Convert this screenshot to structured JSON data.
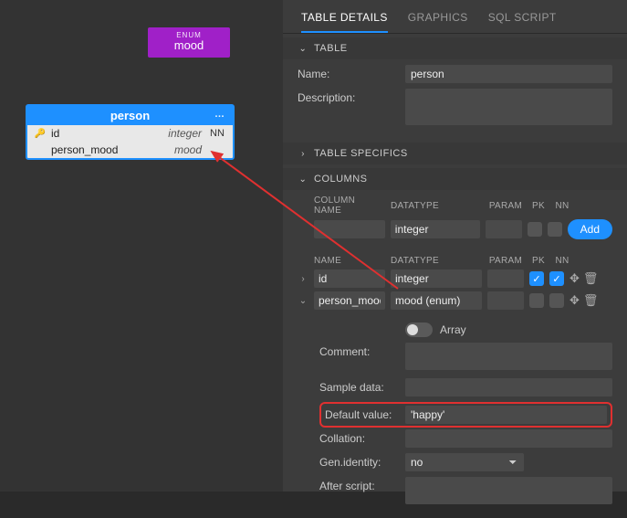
{
  "canvas": {
    "enum": {
      "tag": "ENUM",
      "name": "mood"
    },
    "table": {
      "name": "person",
      "rows": [
        {
          "key": "🔑",
          "name": "id",
          "datatype": "integer",
          "nn": "NN"
        },
        {
          "key": "",
          "name": "person_mood",
          "datatype": "mood",
          "nn": ""
        }
      ]
    }
  },
  "panel": {
    "tabs": [
      "TABLE DETAILS",
      "GRAPHICS",
      "SQL SCRIPT"
    ],
    "active_tab": 0,
    "section_table": "TABLE",
    "name_label": "Name:",
    "name_value": "person",
    "desc_label": "Description:",
    "section_specifics": "TABLE SPECIFICS",
    "section_columns": "COLUMNS",
    "cols_header": {
      "name": "COLUMN NAME",
      "dt": "DATATYPE",
      "param": "PARAM",
      "pk": "PK",
      "nn": "NN"
    },
    "new_col": {
      "name": "",
      "datatype": "integer",
      "param": ""
    },
    "add_label": "Add",
    "col_list_header": {
      "name": "NAME",
      "dt": "DATATYPE",
      "param": "PARAM",
      "pk": "PK",
      "nn": "NN"
    },
    "columns": [
      {
        "name": "id",
        "datatype": "integer",
        "param": "",
        "pk": true,
        "nn": true,
        "expanded": false
      },
      {
        "name": "person_mood",
        "datatype": "mood (enum)",
        "param": "",
        "pk": false,
        "nn": false,
        "expanded": true
      }
    ],
    "detail": {
      "array_label": "Array",
      "comment_label": "Comment:",
      "sample_label": "Sample data:",
      "default_label": "Default value:",
      "default_value": "'happy'",
      "collation_label": "Collation:",
      "gen_identity_label": "Gen.identity:",
      "gen_identity_value": "no",
      "after_script_label": "After script:"
    }
  }
}
